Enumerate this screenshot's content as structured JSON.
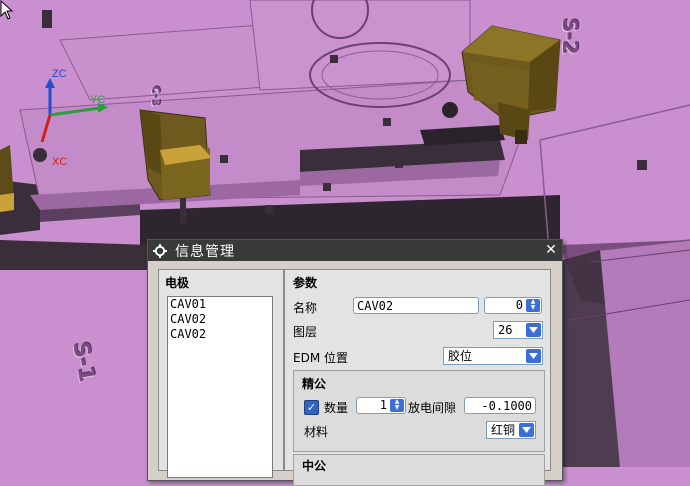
{
  "viewport": {
    "axes": {
      "zc": "ZC",
      "yc": "YC",
      "xc": "XC"
    },
    "embossed_labels": {
      "s2": "S-2",
      "s1": "S-1",
      "c3": "C-3"
    },
    "colors": {
      "mold": "#c98fcf",
      "mold_dark": "#8a5a90",
      "shadow": "#3a2e3a",
      "electrode": "#6e5a1c",
      "electrode_top": "#c9a33a"
    }
  },
  "dialog": {
    "title": "信息管理",
    "close_icon": "close-icon",
    "left": {
      "heading": "电极",
      "electrodes": [
        "CAV01",
        "CAV02",
        "CAV02"
      ]
    },
    "right": {
      "heading": "参数",
      "name_label": "名称",
      "name_value": "CAV02",
      "name_index": "0",
      "layer_label": "图层",
      "layer_value": "26",
      "edm_label": "EDM 位置",
      "edm_value": "胶位",
      "fine": {
        "heading": "精公",
        "count_label": "数量",
        "count_checked": true,
        "count_value": "1",
        "gap_label": "放电间隙",
        "gap_value": "-0.1000",
        "material_label": "材料",
        "material_value": "红铜"
      },
      "medium": {
        "heading": "中公"
      }
    }
  }
}
